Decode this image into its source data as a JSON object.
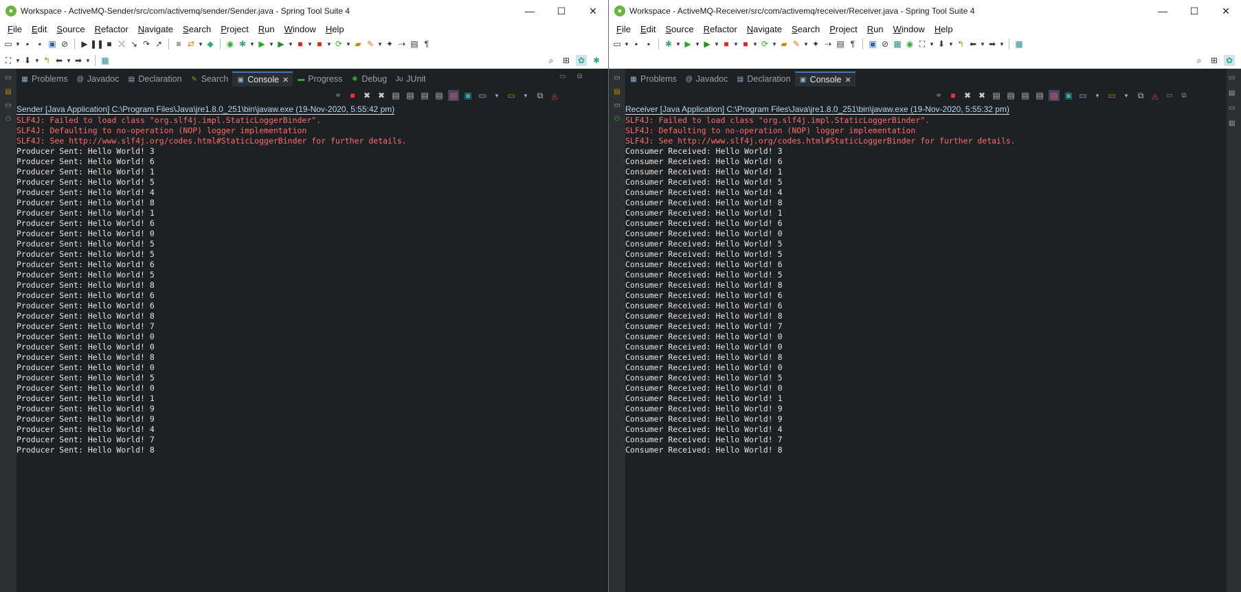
{
  "left": {
    "title": "Workspace - ActiveMQ-Sender/src/com/activemq/sender/Sender.java - Spring Tool Suite 4",
    "menu": [
      "File",
      "Edit",
      "Source",
      "Refactor",
      "Navigate",
      "Search",
      "Project",
      "Run",
      "Window",
      "Help"
    ],
    "tabs": [
      {
        "label": "Problems",
        "active": false,
        "icon": "problems-icon"
      },
      {
        "label": "Javadoc",
        "active": false,
        "icon": "javadoc-icon"
      },
      {
        "label": "Declaration",
        "active": false,
        "icon": "declaration-icon"
      },
      {
        "label": "Search",
        "active": false,
        "icon": "search-icon"
      },
      {
        "label": "Console",
        "active": true,
        "icon": "console-icon"
      },
      {
        "label": "Progress",
        "active": false,
        "icon": "progress-icon"
      },
      {
        "label": "Debug",
        "active": false,
        "icon": "debug-icon"
      },
      {
        "label": "JUnit",
        "active": false,
        "icon": "junit-icon"
      }
    ],
    "process_line": "Sender [Java Application] C:\\Program Files\\Java\\jre1.8.0_251\\bin\\javaw.exe  (19-Nov-2020, 5:55:42 pm)",
    "errors": [
      "SLF4J: Failed to load class \"org.slf4j.impl.StaticLoggerBinder\".",
      "SLF4J: Defaulting to no-operation (NOP) logger implementation",
      "SLF4J: See http://www.slf4j.org/codes.html#StaticLoggerBinder for further details."
    ],
    "output_prefix": "Producer Sent: Hello World! ",
    "output_values": [
      "3",
      "6",
      "1",
      "5",
      "4",
      "8",
      "1",
      "6",
      "0",
      "5",
      "5",
      "6",
      "5",
      "8",
      "6",
      "6",
      "8",
      "7",
      "0",
      "0",
      "8",
      "0",
      "5",
      "0",
      "1",
      "9",
      "9",
      "4",
      "7",
      "8"
    ]
  },
  "right": {
    "title": "Workspace - ActiveMQ-Receiver/src/com/activemq/receiver/Receiver.java - Spring Tool Suite 4",
    "menu": [
      "File",
      "Edit",
      "Source",
      "Refactor",
      "Navigate",
      "Search",
      "Project",
      "Run",
      "Window",
      "Help"
    ],
    "tabs": [
      {
        "label": "Problems",
        "active": false,
        "icon": "problems-icon"
      },
      {
        "label": "Javadoc",
        "active": false,
        "icon": "javadoc-icon"
      },
      {
        "label": "Declaration",
        "active": false,
        "icon": "declaration-icon"
      },
      {
        "label": "Console",
        "active": true,
        "icon": "console-icon"
      }
    ],
    "process_line": "Receiver [Java Application] C:\\Program Files\\Java\\jre1.8.0_251\\bin\\javaw.exe  (19-Nov-2020, 5:55:32 pm)",
    "errors": [
      "SLF4J: Failed to load class \"org.slf4j.impl.StaticLoggerBinder\".",
      "SLF4J: Defaulting to no-operation (NOP) logger implementation",
      "SLF4J: See http://www.slf4j.org/codes.html#StaticLoggerBinder for further details."
    ],
    "output_prefix": "Consumer Received: Hello World! ",
    "output_values": [
      "3",
      "6",
      "1",
      "5",
      "4",
      "8",
      "1",
      "6",
      "0",
      "5",
      "5",
      "6",
      "5",
      "8",
      "6",
      "6",
      "8",
      "7",
      "0",
      "0",
      "8",
      "0",
      "5",
      "0",
      "1",
      "9",
      "9",
      "4",
      "7",
      "8"
    ]
  },
  "colors": {
    "console_bg": "#1e2124",
    "error_text": "#ff6b68",
    "accent": "#3f7ac4"
  }
}
